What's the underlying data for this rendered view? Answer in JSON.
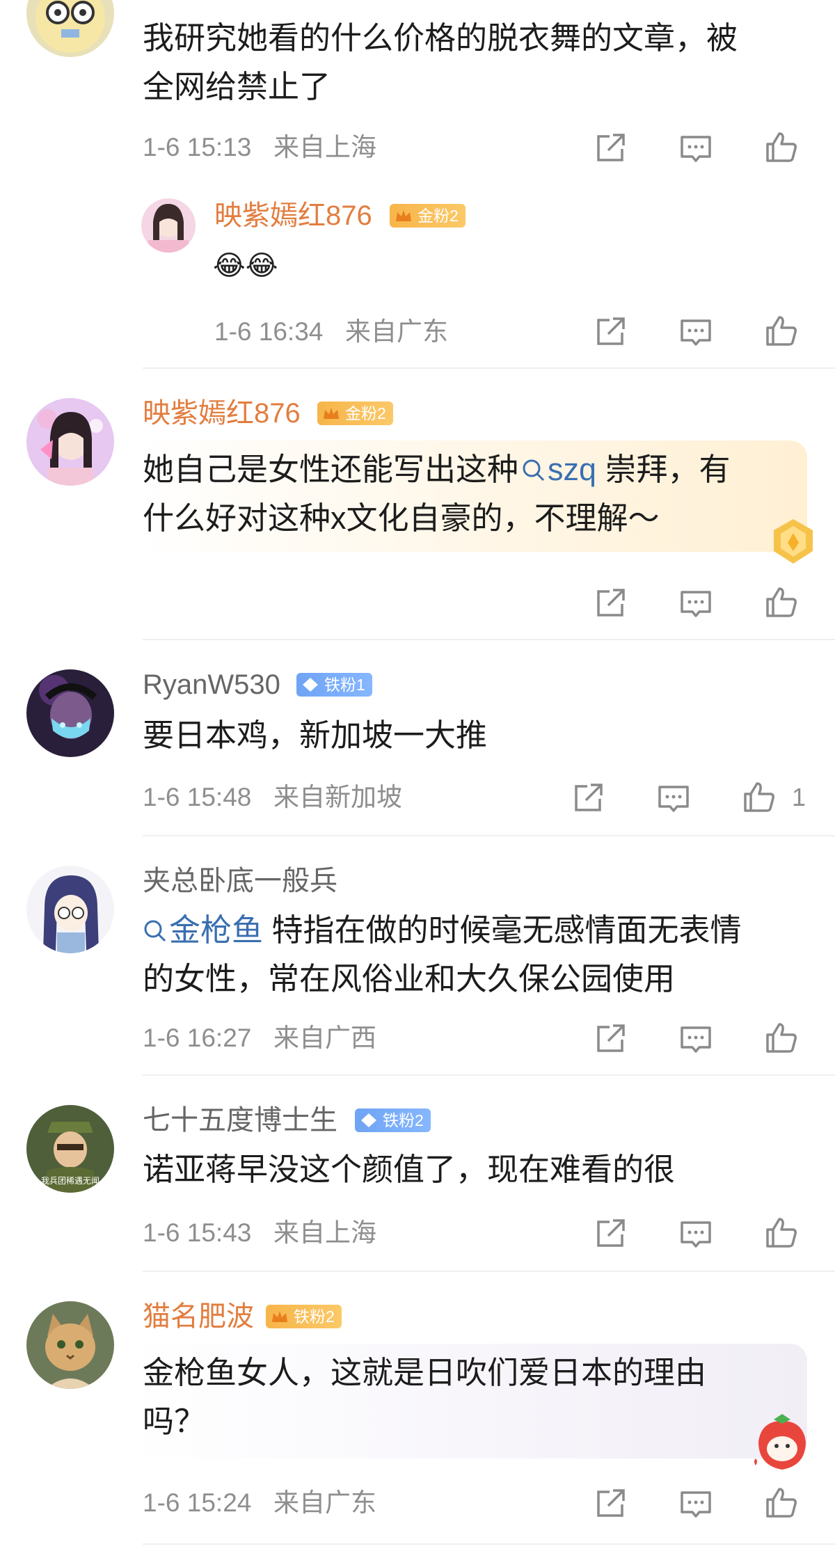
{
  "comments": [
    {
      "text_lines": [
        "我研究她看的什么价格的脱衣舞的文章，被",
        "全网给禁止了"
      ],
      "date": "1-6 15:13",
      "location": "来自上海",
      "reply": {
        "username": "映紫嫣红876",
        "badge": "金粉2",
        "emoji": "😂😂",
        "date": "1-6 16:34",
        "location": "来自广东"
      }
    },
    {
      "username": "映紫嫣红876",
      "badge": "金粉2",
      "text_line1_a": "她自己是女性还能写出这种",
      "text_line1_link": "szq",
      "text_line1_b": " 崇拜，有",
      "text_line2": "什么好对这种x文化自豪的，不理解～"
    },
    {
      "username": "RyanW530",
      "badge": "铁粉1",
      "text": "要日本鸡，新加坡一大推",
      "date": "1-6 15:48",
      "location": "来自新加坡",
      "likes": "1"
    },
    {
      "username": "夹总卧底一般兵",
      "text_link": "金枪鱼",
      "text_line1": " 特指在做的时候毫无感情面无表情",
      "text_line2": "的女性，常在风俗业和大久保公园使用",
      "date": "1-6 16:27",
      "location": "来自广西"
    },
    {
      "username": "七十五度博士生",
      "badge": "铁粉2",
      "avatar_caption": "我兵团稀遇无闻",
      "text": "诺亚蒋早没这个颜值了，现在难看的很",
      "date": "1-6 15:43",
      "location": "来自上海"
    },
    {
      "username": "猫名肥波",
      "badge": "铁粉2",
      "text_lines": [
        "金枪鱼女人，这就是日吹们爱日本的理由",
        "吗？"
      ],
      "date": "1-6 15:24",
      "location": "来自广东"
    }
  ],
  "icons": [
    "share-icon",
    "comment-icon",
    "like-icon",
    "search-link-icon"
  ],
  "colors": {
    "username_highlight": "#e27d3f",
    "link": "#3a6fb0",
    "meta": "#8e8e8e",
    "gold_badge": "#f7b54a",
    "iron_badge": "#6fa4f4"
  }
}
